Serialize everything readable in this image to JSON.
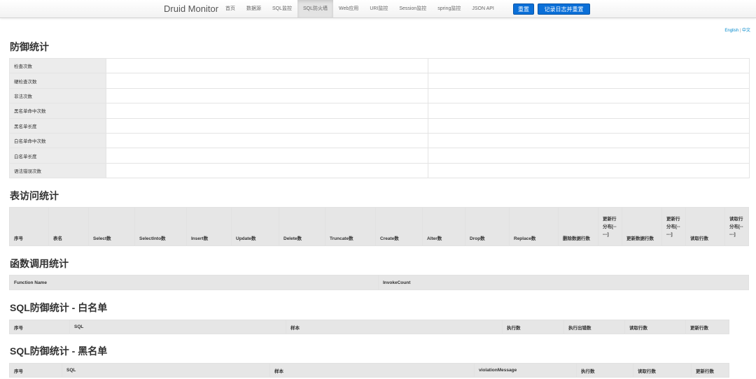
{
  "navbar": {
    "brand": "Druid Monitor",
    "items": [
      "首页",
      "数据源",
      "SQL监控",
      "SQL防火墙",
      "Web应用",
      "URI监控",
      "Session监控",
      "spring监控",
      "JSON API"
    ],
    "active_item": "SQL防火墙",
    "reset_button": "重置",
    "log_reset_button": "记录日志并重置"
  },
  "lang": {
    "english": "English",
    "separator": "|",
    "chinese": "中文"
  },
  "defense": {
    "title": "防御统计",
    "rows": [
      "检查次数",
      "硬检查次数",
      "非法次数",
      "黑名单命中次数",
      "黑名单长度",
      "白名单命中次数",
      "白名单长度",
      "语法错误次数"
    ]
  },
  "table_stats": {
    "title": "表访问统计",
    "headers": [
      "序号",
      "表名",
      "Select数",
      "SelectInto数",
      "Insert数",
      "Update数",
      "Delete数",
      "Truncate数",
      "Create数",
      "Alter数",
      "Drop数",
      "Replace数",
      "删除数据行数",
      "更新行分布[-----]",
      "更新数据行数",
      "更新行分布[-----]",
      "读取行数",
      "读取行分布[-----]"
    ]
  },
  "function_stats": {
    "title": "函数调用统计",
    "headers": [
      "Function Name",
      "InvokeCount"
    ]
  },
  "whitelist": {
    "title": "SQL防御统计 - 白名单",
    "headers": [
      "序号",
      "SQL",
      "样本",
      "执行数",
      "执行出错数",
      "读取行数",
      "更新行数"
    ]
  },
  "blacklist": {
    "title": "SQL防御统计 - 黑名单",
    "headers": [
      "序号",
      "SQL",
      "样本",
      "violationMessage",
      "执行数",
      "读取行数",
      "更新行数"
    ]
  },
  "colors": {
    "accent": "#0a6fd8",
    "header_bg": "#e6e6e6",
    "link": "#08c"
  }
}
